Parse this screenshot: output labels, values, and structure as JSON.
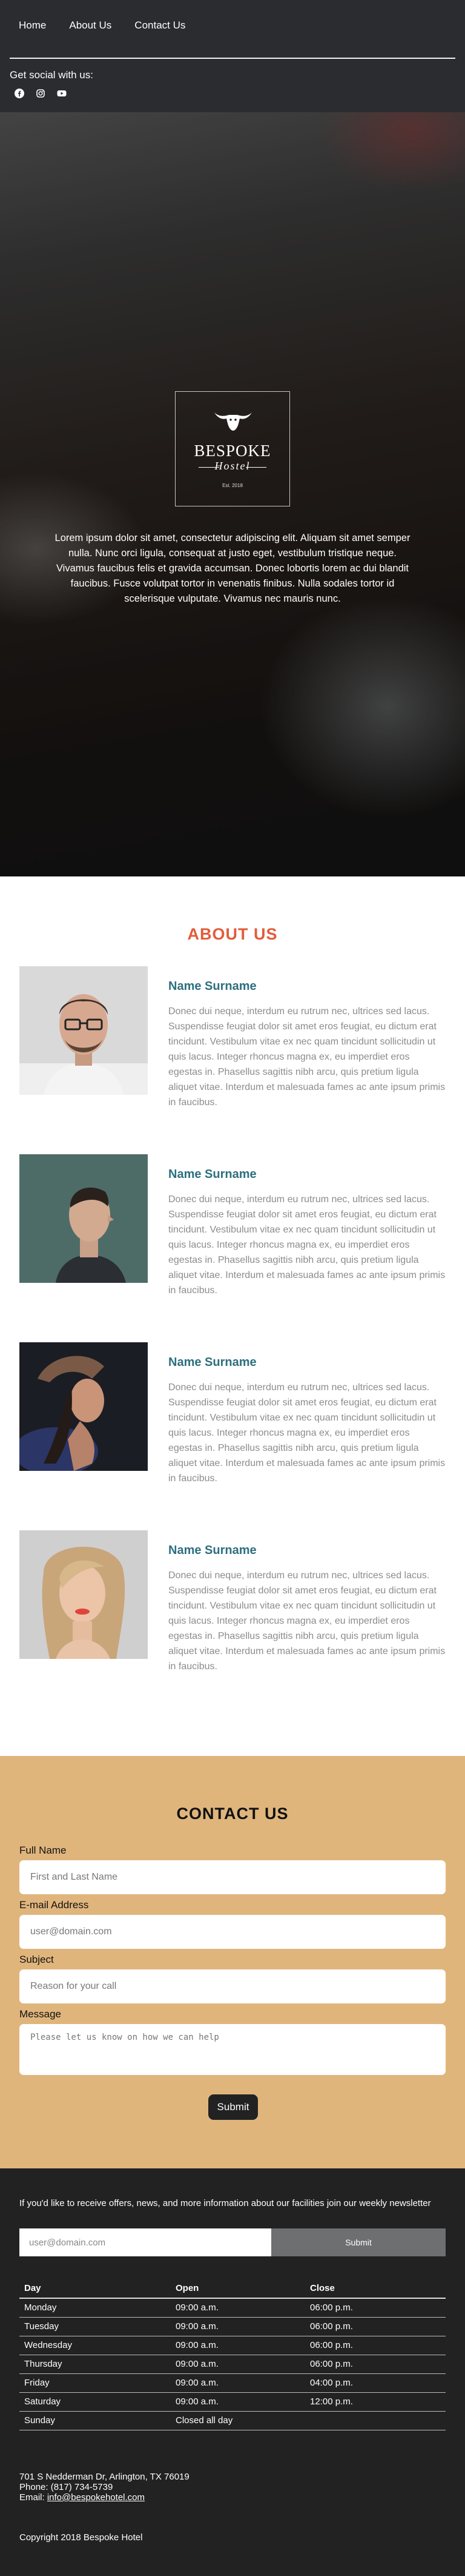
{
  "nav": {
    "items": [
      {
        "label": "Home"
      },
      {
        "label": "About Us"
      },
      {
        "label": "Contact Us"
      }
    ]
  },
  "social": {
    "title": "Get social with us:",
    "icons": [
      "facebook-icon",
      "instagram-icon",
      "youtube-icon"
    ]
  },
  "hero": {
    "logo": {
      "word": "BESPOKE",
      "sub": "Hostel",
      "est": "Est. 2018"
    },
    "text": "Lorem ipsum dolor sit amet, consectetur adipiscing elit. Aliquam sit amet semper nulla. Nunc orci ligula, consequat at justo eget, vestibulum tristique neque. Vivamus faucibus felis et gravida accumsan. Donec lobortis lorem ac dui blandit faucibus. Fusce volutpat tortor in venenatis finibus. Nulla sodales tortor id scelerisque vulputate. Vivamus nec mauris nunc."
  },
  "about": {
    "title": "ABOUT US",
    "members": [
      {
        "name": "Name Surname",
        "bio": "Donec dui neque, interdum eu rutrum nec, ultrices sed lacus. Suspendisse feugiat dolor sit amet eros feugiat, eu dictum erat tincidunt. Vestibulum vitae ex nec quam tincidunt sollicitudin ut quis lacus. Integer rhoncus magna ex, eu imperdiet eros egestas in. Phasellus sagittis nibh arcu, quis pretium ligula aliquet vitae. Interdum et malesuada fames ac ante ipsum primis in faucibus."
      },
      {
        "name": "Name Surname",
        "bio": "Donec dui neque, interdum eu rutrum nec, ultrices sed lacus. Suspendisse feugiat dolor sit amet eros feugiat, eu dictum erat tincidunt. Vestibulum vitae ex nec quam tincidunt sollicitudin ut quis lacus. Integer rhoncus magna ex, eu imperdiet eros egestas in. Phasellus sagittis nibh arcu, quis pretium ligula aliquet vitae. Interdum et malesuada fames ac ante ipsum primis in faucibus."
      },
      {
        "name": "Name Surname",
        "bio": "Donec dui neque, interdum eu rutrum nec, ultrices sed lacus. Suspendisse feugiat dolor sit amet eros feugiat, eu dictum erat tincidunt. Vestibulum vitae ex nec quam tincidunt sollicitudin ut quis lacus. Integer rhoncus magna ex, eu imperdiet eros egestas in. Phasellus sagittis nibh arcu, quis pretium ligula aliquet vitae. Interdum et malesuada fames ac ante ipsum primis in faucibus."
      },
      {
        "name": "Name Surname",
        "bio": "Donec dui neque, interdum eu rutrum nec, ultrices sed lacus. Suspendisse feugiat dolor sit amet eros feugiat, eu dictum erat tincidunt. Vestibulum vitae ex nec quam tincidunt sollicitudin ut quis lacus. Integer rhoncus magna ex, eu imperdiet eros egestas in. Phasellus sagittis nibh arcu, quis pretium ligula aliquet vitae. Interdum et malesuada fames ac ante ipsum primis in faucibus."
      }
    ]
  },
  "contact": {
    "title": "CONTACT US",
    "fields": {
      "name": {
        "label": "Full Name",
        "placeholder": "First and Last Name"
      },
      "email": {
        "label": "E-mail Address",
        "placeholder": "user@domain.com"
      },
      "subject": {
        "label": "Subject",
        "placeholder": "Reason for your call"
      },
      "message": {
        "label": "Message",
        "placeholder": "Please let us know on how we can help"
      }
    },
    "submit_label": "Submit"
  },
  "footer": {
    "newsletter_text": "If you'd like to receive offers, news, and more information about our facilities join our weekly newsletter",
    "newsletter_placeholder": "user@domain.com",
    "newsletter_submit": "Submit",
    "hours": {
      "headers": [
        "Day",
        "Open",
        "Close"
      ],
      "rows": [
        [
          "Monday",
          "09:00 a.m.",
          "06:00 p.m."
        ],
        [
          "Tuesday",
          "09:00 a.m.",
          "06:00 p.m."
        ],
        [
          "Wednesday",
          "09:00 a.m.",
          "06:00 p.m."
        ],
        [
          "Thursday",
          "09:00 a.m.",
          "06:00 p.m."
        ],
        [
          "Friday",
          "09:00 a.m.",
          "04:00 p.m."
        ],
        [
          "Saturday",
          "09:00 a.m.",
          "12:00 p.m."
        ],
        [
          "Sunday",
          "Closed all day",
          ""
        ]
      ]
    },
    "address": "701 S Nedderman Dr, Arlington, TX 76019",
    "phone": "Phone: (817) 734-5739",
    "email_label": "Email: ",
    "email": "info@bespokehotel.com",
    "copyright": "Copyright 2018 Bespoke Hotel"
  },
  "colors": {
    "header_bg": "#2a2c30",
    "about_title": "#e35b3a",
    "member_name": "#2d6f7f",
    "contact_bg": "#e0b57c",
    "footer_bg": "#222222"
  }
}
